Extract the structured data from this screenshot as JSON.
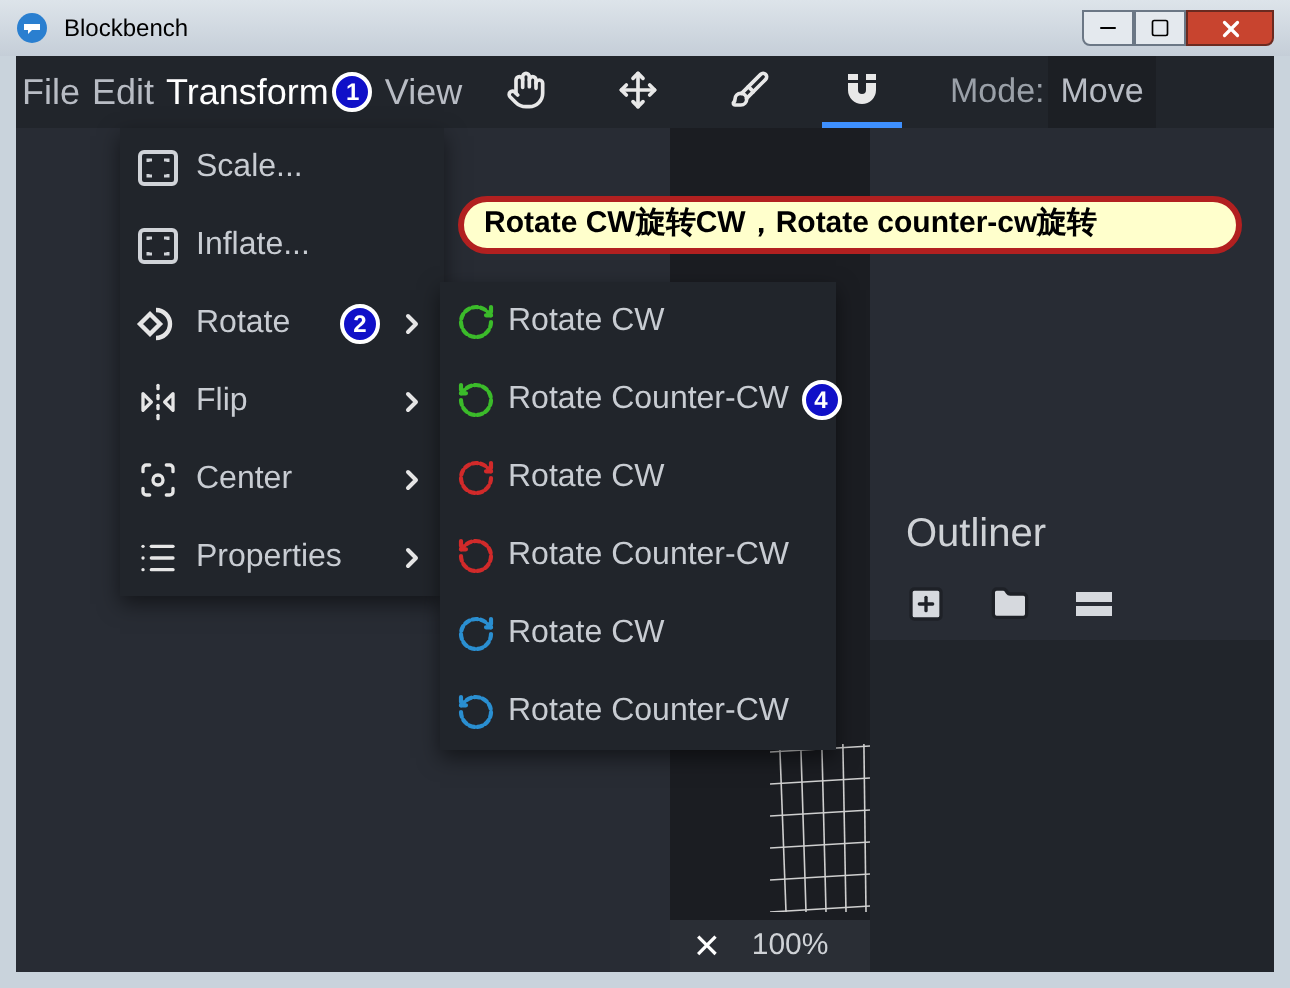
{
  "window": {
    "title": "Blockbench"
  },
  "menu_bar": [
    {
      "label": "File",
      "selected": false
    },
    {
      "label": "Edit",
      "selected": false
    },
    {
      "label": "Transform",
      "selected": true,
      "badge": "1"
    },
    {
      "label": "View",
      "selected": false
    }
  ],
  "tools": [
    {
      "kind": "hand",
      "selected": false
    },
    {
      "kind": "move",
      "selected": false
    },
    {
      "kind": "brush",
      "selected": false
    },
    {
      "kind": "magnet",
      "selected": true
    }
  ],
  "mode": {
    "label": "Mode:",
    "value": "Move"
  },
  "transform_menu": [
    {
      "kind": "scale",
      "label": "Scale...",
      "submenu": false
    },
    {
      "kind": "inflate",
      "label": "Inflate...",
      "submenu": false
    },
    {
      "kind": "rotate",
      "label": "Rotate",
      "submenu": true,
      "badge": "2"
    },
    {
      "kind": "flip",
      "label": "Flip",
      "submenu": true
    },
    {
      "kind": "center",
      "label": "Center",
      "submenu": true
    },
    {
      "kind": "properties",
      "label": "Properties",
      "submenu": true
    }
  ],
  "rotate_submenu": [
    {
      "kind": "cw",
      "label": "Rotate CW",
      "color": "#3bbb2a"
    },
    {
      "kind": "ccw",
      "label": "Rotate Counter-CW",
      "color": "#3bbb2a",
      "badge": "4"
    },
    {
      "kind": "cw",
      "label": "Rotate CW",
      "color": "#d12a2a"
    },
    {
      "kind": "ccw",
      "label": "Rotate Counter-CW",
      "color": "#d12a2a"
    },
    {
      "kind": "cw",
      "label": "Rotate CW",
      "color": "#2a8fd1"
    },
    {
      "kind": "ccw",
      "label": "Rotate Counter-CW",
      "color": "#2a8fd1"
    }
  ],
  "annotation": "Rotate CW旋转CW，Rotate counter-cw旋转",
  "outliner": {
    "title": "Outliner",
    "tools": [
      {
        "kind": "add-cube"
      },
      {
        "kind": "add-group"
      },
      {
        "kind": "collapse"
      }
    ]
  },
  "viewport_status": {
    "close": "×",
    "zoom": "100%"
  }
}
